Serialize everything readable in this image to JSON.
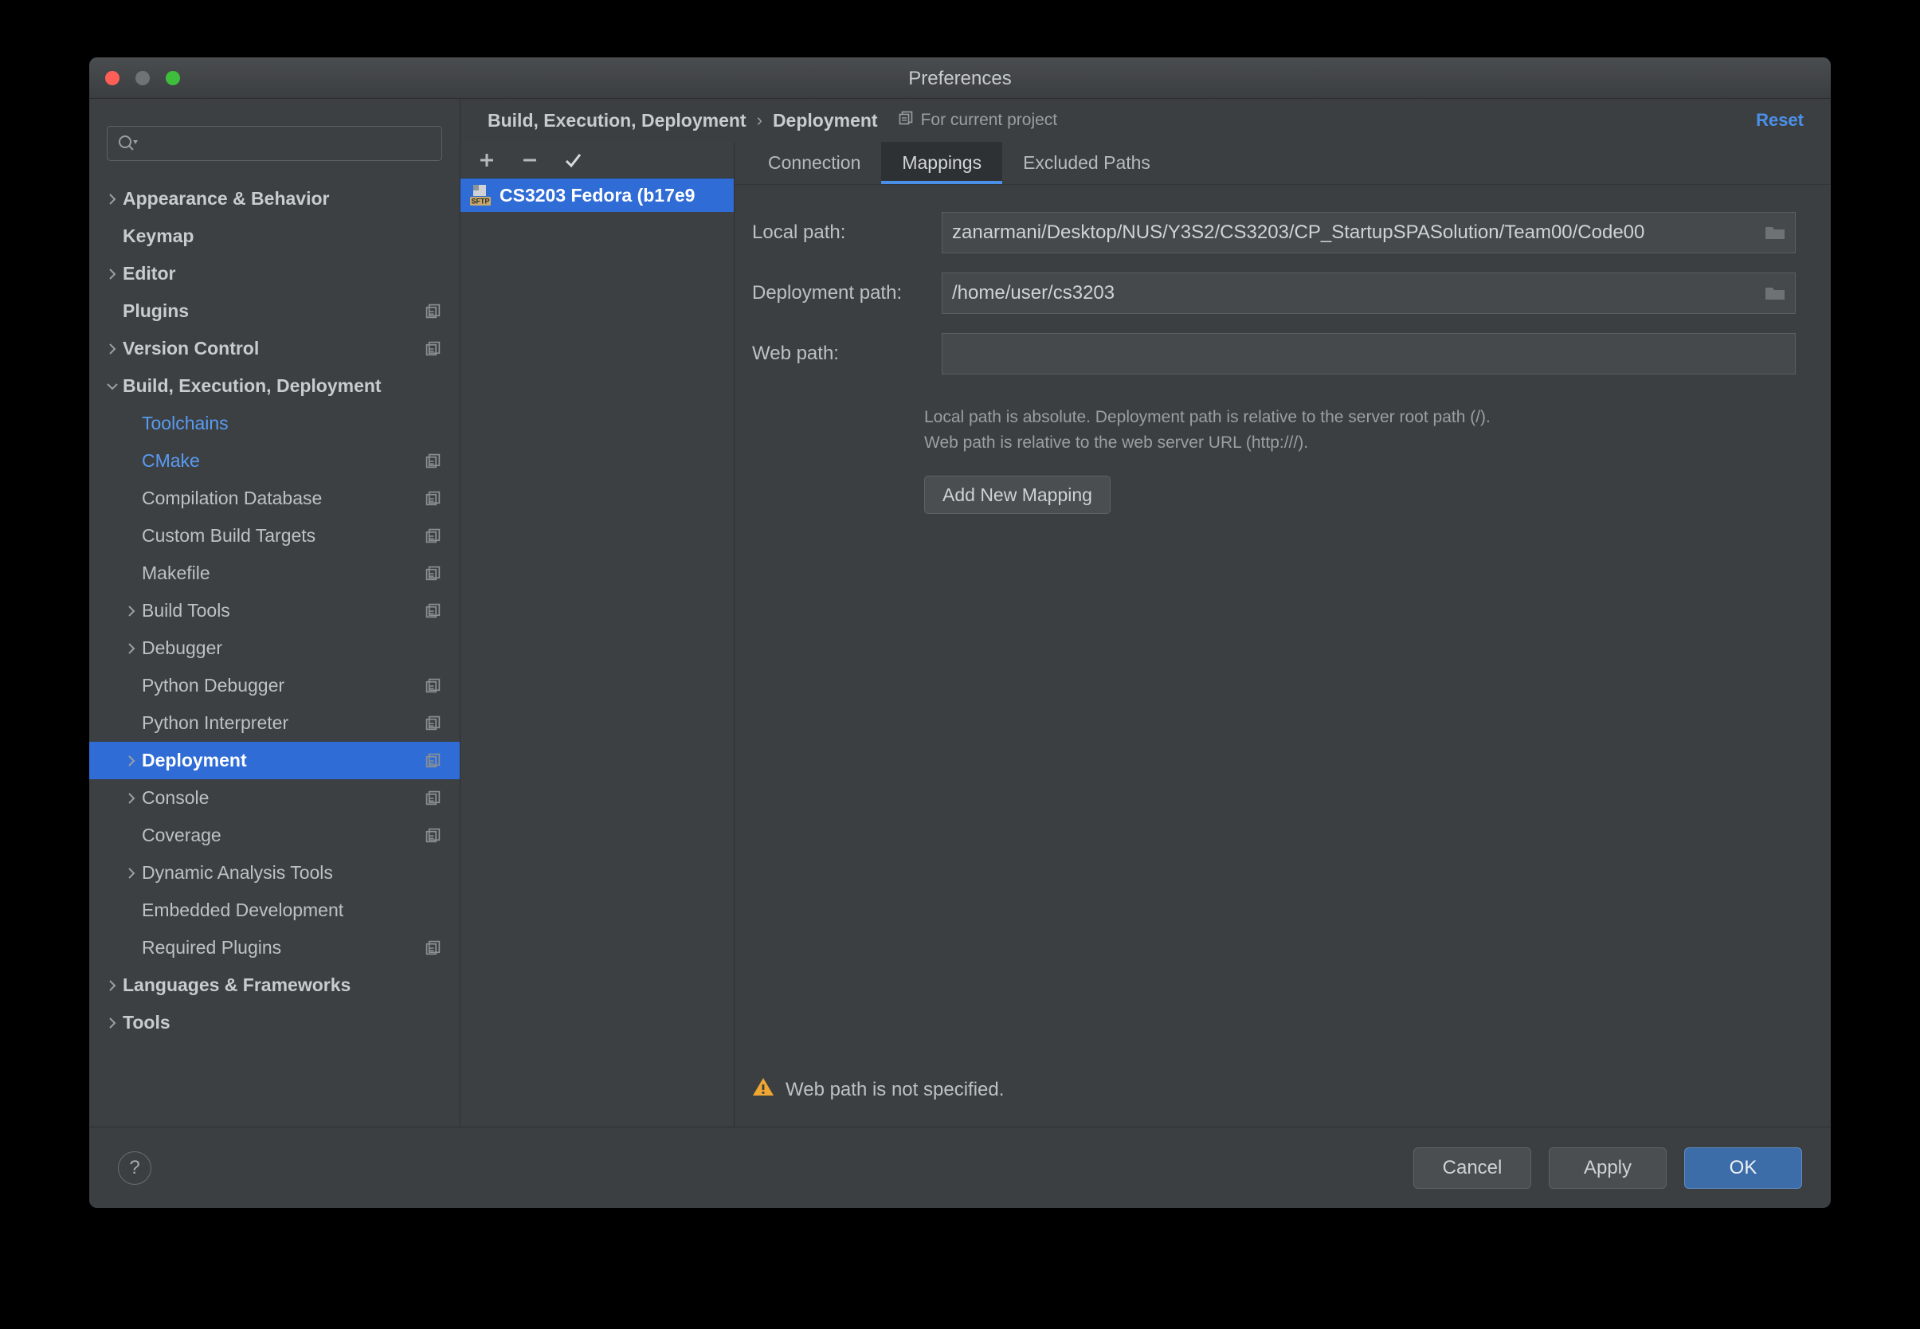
{
  "window": {
    "title": "Preferences",
    "traffic_lights": [
      "close",
      "minimize",
      "maximize"
    ]
  },
  "sidebar": {
    "search_placeholder": "",
    "search_value": "",
    "items": [
      {
        "label": "Appearance & Behavior",
        "arrow": "right",
        "bold": true,
        "indent": 0,
        "copy": false,
        "state": "normal"
      },
      {
        "label": "Keymap",
        "arrow": "none",
        "bold": true,
        "indent": 0,
        "copy": false,
        "state": "normal"
      },
      {
        "label": "Editor",
        "arrow": "right",
        "bold": true,
        "indent": 0,
        "copy": false,
        "state": "normal"
      },
      {
        "label": "Plugins",
        "arrow": "none",
        "bold": true,
        "indent": 0,
        "copy": true,
        "state": "normal"
      },
      {
        "label": "Version Control",
        "arrow": "right",
        "bold": true,
        "indent": 0,
        "copy": true,
        "state": "normal"
      },
      {
        "label": "Build, Execution, Deployment",
        "arrow": "down",
        "bold": true,
        "indent": 0,
        "copy": false,
        "state": "normal"
      },
      {
        "label": "Toolchains",
        "arrow": "none",
        "bold": false,
        "indent": 1,
        "copy": false,
        "state": "modified"
      },
      {
        "label": "CMake",
        "arrow": "none",
        "bold": false,
        "indent": 1,
        "copy": true,
        "state": "modified"
      },
      {
        "label": "Compilation Database",
        "arrow": "none",
        "bold": false,
        "indent": 1,
        "copy": true,
        "state": "normal"
      },
      {
        "label": "Custom Build Targets",
        "arrow": "none",
        "bold": false,
        "indent": 1,
        "copy": true,
        "state": "normal"
      },
      {
        "label": "Makefile",
        "arrow": "none",
        "bold": false,
        "indent": 1,
        "copy": true,
        "state": "normal"
      },
      {
        "label": "Build Tools",
        "arrow": "right",
        "bold": false,
        "indent": 1,
        "copy": true,
        "state": "normal"
      },
      {
        "label": "Debugger",
        "arrow": "right",
        "bold": false,
        "indent": 1,
        "copy": false,
        "state": "normal"
      },
      {
        "label": "Python Debugger",
        "arrow": "none",
        "bold": false,
        "indent": 1,
        "copy": true,
        "state": "normal"
      },
      {
        "label": "Python Interpreter",
        "arrow": "none",
        "bold": false,
        "indent": 1,
        "copy": true,
        "state": "normal"
      },
      {
        "label": "Deployment",
        "arrow": "right",
        "bold": false,
        "indent": 1,
        "copy": true,
        "state": "selected"
      },
      {
        "label": "Console",
        "arrow": "right",
        "bold": false,
        "indent": 1,
        "copy": true,
        "state": "normal"
      },
      {
        "label": "Coverage",
        "arrow": "none",
        "bold": false,
        "indent": 1,
        "copy": true,
        "state": "normal"
      },
      {
        "label": "Dynamic Analysis Tools",
        "arrow": "right",
        "bold": false,
        "indent": 1,
        "copy": false,
        "state": "normal"
      },
      {
        "label": "Embedded Development",
        "arrow": "none",
        "bold": false,
        "indent": 1,
        "copy": false,
        "state": "normal"
      },
      {
        "label": "Required Plugins",
        "arrow": "none",
        "bold": false,
        "indent": 1,
        "copy": true,
        "state": "normal"
      },
      {
        "label": "Languages & Frameworks",
        "arrow": "right",
        "bold": true,
        "indent": 0,
        "copy": false,
        "state": "normal"
      },
      {
        "label": "Tools",
        "arrow": "right",
        "bold": true,
        "indent": 0,
        "copy": false,
        "state": "normal"
      }
    ]
  },
  "breadcrumb": {
    "root": "Build, Execution, Deployment",
    "separator": "›",
    "leaf": "Deployment",
    "scope_label": "For current project",
    "reset_label": "Reset"
  },
  "server_panel": {
    "toolbar": [
      {
        "name": "add",
        "glyph": "+"
      },
      {
        "name": "remove",
        "glyph": "−"
      },
      {
        "name": "set-default",
        "glyph": "✓"
      }
    ],
    "servers": [
      {
        "label": "CS3203 Fedora (b17e9",
        "protocol": "SFTP",
        "selected": true
      }
    ]
  },
  "tabs": [
    {
      "label": "Connection",
      "active": false
    },
    {
      "label": "Mappings",
      "active": true
    },
    {
      "label": "Excluded Paths",
      "active": false
    }
  ],
  "mappings_form": {
    "fields": [
      {
        "label": "Local path:",
        "value": "zanarmani/Desktop/NUS/Y3S2/CS3203/CP_StartupSPASolution/Team00/Code00",
        "browse": true
      },
      {
        "label": "Deployment path:",
        "value": "/home/user/cs3203",
        "browse": true
      },
      {
        "label": "Web path:",
        "value": "",
        "browse": false
      }
    ],
    "hint_line_1": "Local path is absolute. Deployment path is relative to the server root path (/).",
    "hint_line_2": "Web path is relative to the web server URL (http:///).",
    "add_mapping_label": "Add New Mapping"
  },
  "status": {
    "warning_text": "Web path is not specified."
  },
  "footer": {
    "help_label": "?",
    "buttons": [
      {
        "label": "Cancel",
        "primary": false
      },
      {
        "label": "Apply",
        "primary": false
      },
      {
        "label": "OK",
        "primary": true
      }
    ]
  },
  "colors": {
    "window_bg": "#3c3f41",
    "sidebar_bg": "#3c4043",
    "selection_blue": "#2f6cd5",
    "accent_blue": "#4a90e8",
    "modified_blue": "#5a9bf0",
    "warning_amber": "#f0a732",
    "primary_button": "#3c6da8",
    "text_primary": "#bdc1c4",
    "text_muted": "#9a9fa3"
  }
}
